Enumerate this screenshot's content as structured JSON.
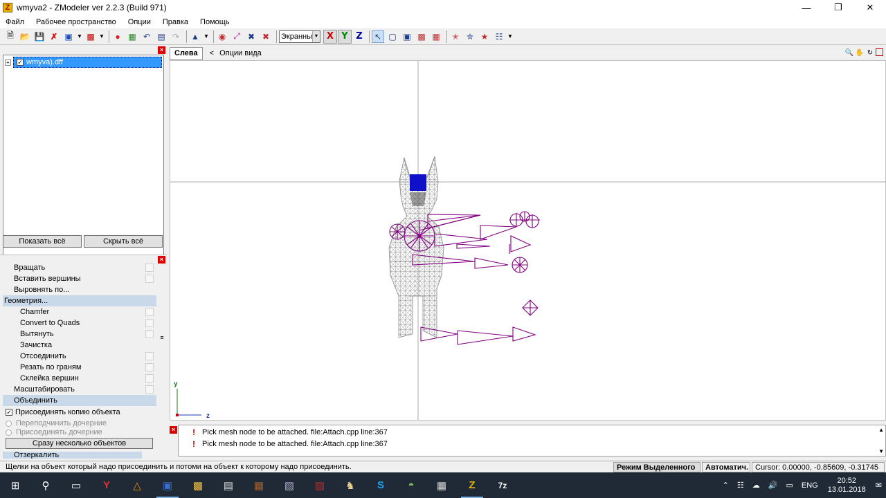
{
  "window": {
    "title": "wmyva2 - ZModeler ver 2.2.3 (Build 971)",
    "app_icon_letter": "Z",
    "minimize_icon": "minimize-icon",
    "maximize_icon": "restore-icon",
    "close_icon": "close-icon"
  },
  "menu": [
    "Файл",
    "Рабочее пространство",
    "Опции",
    "Правка",
    "Помощь"
  ],
  "toolbar": {
    "view_select": "Экранны",
    "axis_x": "X",
    "axis_y": "Y",
    "axis_z": "Z"
  },
  "scene_tree": {
    "item_label": "wmyva).dff",
    "item_checked": true,
    "show_all": "Показать всё",
    "hide_all": "Скрыть всё"
  },
  "commands": {
    "items": [
      {
        "label": "Вращать",
        "type": "top"
      },
      {
        "label": "Вставить вершины",
        "type": "top"
      },
      {
        "label": "Выровнять по...",
        "type": "top"
      },
      {
        "label": "Геометрия...",
        "type": "header"
      },
      {
        "label": "Chamfer",
        "type": "sub"
      },
      {
        "label": "Convert to Quads",
        "type": "sub"
      },
      {
        "label": "Вытянуть",
        "type": "sub"
      },
      {
        "label": "Зачистка",
        "type": "sub"
      },
      {
        "label": "Отсоединить",
        "type": "sub"
      },
      {
        "label": "Резать по граням",
        "type": "sub"
      },
      {
        "label": "Склейка вершин",
        "type": "sub"
      },
      {
        "label": "Масштабировать",
        "type": "top"
      },
      {
        "label": "Объединить",
        "type": "header"
      }
    ],
    "option_copy": "Присоединять копию объекта",
    "option_reparent": "Переподчинить дочерние",
    "option_attach_children": "Присоединять дочерние",
    "multi_button": "Сразу несколько объектов",
    "next_header": "Отзеркалить"
  },
  "viewport": {
    "tab": "Слева",
    "options_arrow": "<",
    "options": "Опции вида",
    "axis_y": "y",
    "axis_z": "z"
  },
  "log": [
    "Pick mesh node to be attached. file:Attach.cpp line:367",
    "Pick mesh node to be attached. file:Attach.cpp line:367"
  ],
  "status": {
    "hint": "Щелки на объект который надо присоединить и потоми на объект к которому надо присоединить.",
    "mode": "Режим Выделенного",
    "auto": "Автоматич.",
    "cursor": "Cursor: 0.00000, -0.85609, -0.31745"
  },
  "taskbar": {
    "lang": "ENG",
    "time": "20:52",
    "date": "13.01.2018"
  }
}
